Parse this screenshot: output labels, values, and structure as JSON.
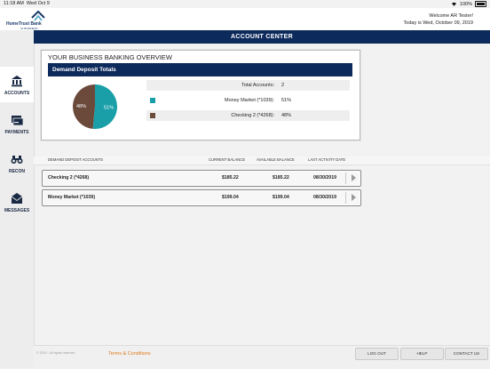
{
  "status_bar": {
    "time": "11:18 AM",
    "date": "Wed Oct 9",
    "battery": "100%",
    "wifi_icon": "wifi-icon",
    "battery_icon": "battery-icon"
  },
  "header": {
    "logo_name": "HomeTrust Bank",
    "logo_sub": "for BUSINESS",
    "welcome": "Welcome AR Tester!",
    "today": "Today is Wed, October 09, 2019"
  },
  "sidebar": {
    "items": [
      {
        "label": "ACCOUNTS",
        "icon": "bank-icon",
        "active": true
      },
      {
        "label": "PAYMENTS",
        "icon": "payments-icon",
        "active": false
      },
      {
        "label": "RECON",
        "icon": "binoculars-icon",
        "active": false
      },
      {
        "label": "MESSAGES",
        "icon": "envelope-icon",
        "active": false
      }
    ]
  },
  "page_title": "ACCOUNT CENTER",
  "overview": {
    "title": "YOUR BUSINESS BANKING OVERVIEW",
    "section_title": "Demand Deposit Totals",
    "total_accounts_label": "Total Accounts:",
    "total_accounts_value": "2",
    "rows": [
      {
        "label": "Money Market (*1039):",
        "value": "51%",
        "color": "#1a9fa8"
      },
      {
        "label": "Checking 2 (*4268):",
        "value": "48%",
        "color": "#6b4a3c"
      }
    ],
    "pie": [
      {
        "label": "48%",
        "percent": 48,
        "color": "#6b4a3c"
      },
      {
        "label": "51%",
        "percent": 51,
        "color": "#1a9fa8"
      }
    ]
  },
  "account_list": {
    "headers": {
      "name": "DEMAND DEPOSIT ACCOUNTS",
      "current": "CURRENT BALANCE",
      "available": "AVAILABLE BALANCE",
      "last": "LAST ACTIVITY DATE"
    },
    "rows": [
      {
        "name": "Checking 2 (*4268)",
        "current": "$185.22",
        "available": "$185.22",
        "last": "08/30/2019"
      },
      {
        "name": "Money Market (*1039)",
        "current": "$199.04",
        "available": "$199.04",
        "last": "08/30/2019"
      }
    ]
  },
  "footer": {
    "copyright": "© 2019 - All rights reserved",
    "terms": "Terms & Conditions",
    "logout": "LOG OUT",
    "help": "HELP",
    "contact": "CONTACT US"
  },
  "colors": {
    "navy": "#0d2a5c",
    "teal": "#1a9fa8",
    "brown": "#6b4a3c",
    "orange": "#e07a1a"
  }
}
